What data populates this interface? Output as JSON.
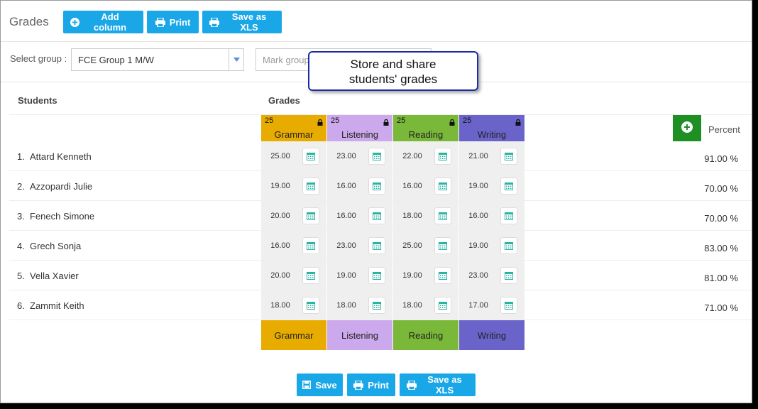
{
  "page": {
    "title": "Grades"
  },
  "toolbar": {
    "add_column": "Add column",
    "print": "Print",
    "save_xls": "Save as XLS"
  },
  "filters": {
    "group_label": "Select group :",
    "group_value": "FCE Group 1 M/W",
    "mark_group_placeholder": "Mark group"
  },
  "callout": {
    "line1": "Store and share",
    "line2": "students' grades"
  },
  "table": {
    "students_header": "Students",
    "grades_header": "Grades",
    "percent_header": "Percent",
    "columns": [
      {
        "name": "Grammar",
        "max": "25",
        "color": "#e8ac00"
      },
      {
        "name": "Listening",
        "max": "25",
        "color": "#cca9ec"
      },
      {
        "name": "Reading",
        "max": "25",
        "color": "#7ab83a"
      },
      {
        "name": "Writing",
        "max": "25",
        "color": "#6a63c9"
      }
    ],
    "rows": [
      {
        "num": "1.",
        "name": "Attard Kenneth",
        "grades": [
          "25.00",
          "23.00",
          "22.00",
          "21.00"
        ],
        "percent": "91.00 %"
      },
      {
        "num": "2.",
        "name": "Azzopardi Julie",
        "grades": [
          "19.00",
          "16.00",
          "16.00",
          "19.00"
        ],
        "percent": "70.00 %"
      },
      {
        "num": "3.",
        "name": "Fenech Simone",
        "grades": [
          "20.00",
          "16.00",
          "18.00",
          "16.00"
        ],
        "percent": "70.00 %"
      },
      {
        "num": "4.",
        "name": "Grech Sonja",
        "grades": [
          "16.00",
          "23.00",
          "25.00",
          "19.00"
        ],
        "percent": "83.00 %"
      },
      {
        "num": "5.",
        "name": "Vella Xavier",
        "grades": [
          "20.00",
          "19.00",
          "19.00",
          "23.00"
        ],
        "percent": "81.00 %"
      },
      {
        "num": "6.",
        "name": "Zammit Keith",
        "grades": [
          "18.00",
          "18.00",
          "18.00",
          "17.00"
        ],
        "percent": "71.00 %"
      }
    ]
  },
  "bottom_toolbar": {
    "save": "Save",
    "print": "Print",
    "save_xls": "Save as XLS"
  },
  "icons": {
    "add": "plus-circle-icon",
    "print": "printer-icon",
    "save": "floppy-disk-icon",
    "calendar": "calendar-icon",
    "lock": "lock-icon",
    "dropdown": "chevron-down-icon"
  },
  "colors": {
    "primary_button": "#1aa7e8",
    "add_column_button": "#1e8f23",
    "callout_border": "#1b2ba8"
  }
}
